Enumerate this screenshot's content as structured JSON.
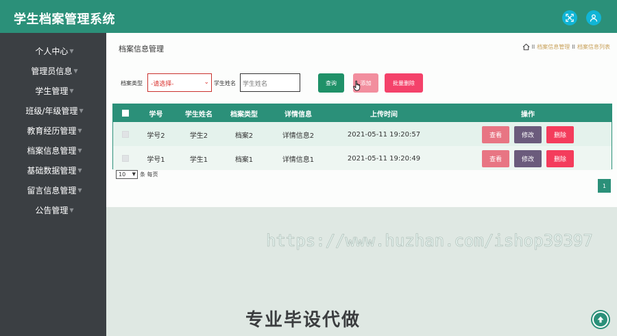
{
  "app": {
    "title": "学生档案管理系统"
  },
  "topbar": {
    "fullscreen_icon": "expand-icon",
    "user_icon": "user-icon",
    "accent": "#2b9079",
    "icon_bg": "#11b5d6"
  },
  "sidebar": {
    "items": [
      {
        "label": "个人中心"
      },
      {
        "label": "管理员信息"
      },
      {
        "label": "学生管理"
      },
      {
        "label": "班级/年级管理"
      },
      {
        "label": "教育经历管理"
      },
      {
        "label": "档案信息管理"
      },
      {
        "label": "基础数据管理"
      },
      {
        "label": "留言信息管理"
      },
      {
        "label": "公告管理"
      }
    ]
  },
  "page": {
    "heading": "档案信息管理",
    "breadcrumb": {
      "sep": "II",
      "level1": "档案信息管理",
      "level2": "档案信息列表"
    }
  },
  "search": {
    "type_label": "档案类型",
    "type_value": "-请选择-",
    "name_label": "学生姓名",
    "name_placeholder": "学生姓名",
    "query_button": "查询",
    "add_button": "添加",
    "batch_delete_button": "批量删除"
  },
  "table": {
    "columns": [
      "学号",
      "学生姓名",
      "档案类型",
      "详情信息",
      "上传时间",
      "操作"
    ],
    "rows": [
      {
        "id": "学号2",
        "name": "学生2",
        "type": "档案2",
        "detail": "详情信息2",
        "time": "2021-05-11 19:20:57"
      },
      {
        "id": "学号1",
        "name": "学生1",
        "type": "档案1",
        "detail": "详情信息1",
        "time": "2021-05-11 19:20:49"
      }
    ],
    "actions": {
      "view": "查看",
      "edit": "修改",
      "delete": "删除"
    }
  },
  "pagination": {
    "page_size": "10",
    "page_size_suffix": "条 每页",
    "current_page": "1"
  },
  "watermark": {
    "url": "https://www.huzhan.com/ishop39397",
    "slogan": "专业毕设代做"
  }
}
